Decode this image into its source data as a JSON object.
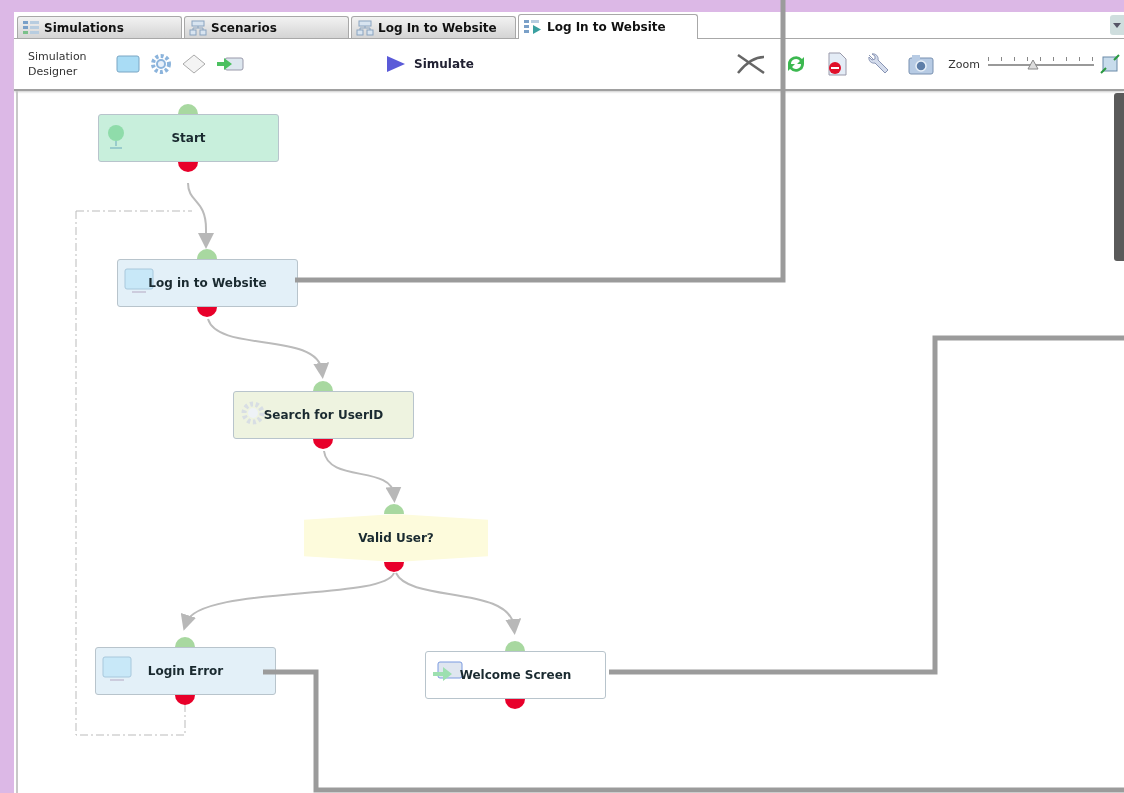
{
  "tabs": [
    {
      "label": "Simulations",
      "kind": "list",
      "selected": false
    },
    {
      "label": "Scenarios",
      "kind": "scenario",
      "selected": false
    },
    {
      "label": "Log In to Website",
      "kind": "scenario",
      "selected": false
    },
    {
      "label": "Log In to Website",
      "kind": "simulation",
      "selected": true
    }
  ],
  "toolbar": {
    "title": "Simulation Designer",
    "simulate_button": "Simulate",
    "zoom": {
      "label": "Zoom",
      "level": 0.42
    }
  },
  "diagram": {
    "nodes": [
      {
        "label": "Start",
        "kind": "start"
      },
      {
        "label": "Log in to Website",
        "kind": "screen"
      },
      {
        "label": "Search for UserID",
        "kind": "action"
      },
      {
        "label": "Valid User?",
        "kind": "decision"
      },
      {
        "label": "Login Error",
        "kind": "screen"
      },
      {
        "label": "Welcome Screen",
        "kind": "flow"
      }
    ]
  }
}
